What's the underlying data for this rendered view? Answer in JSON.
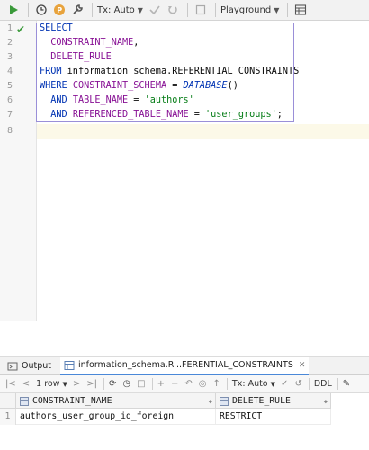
{
  "toolbar": {
    "tx_mode": "Tx: Auto",
    "playground": "Playground"
  },
  "editor": {
    "line_numbers": [
      "1",
      "2",
      "3",
      "4",
      "5",
      "6",
      "7",
      "8"
    ],
    "lines": [
      [
        {
          "t": "SELECT",
          "c": "kw"
        }
      ],
      [
        {
          "t": "  CONSTRAINT_NAME",
          "c": "id"
        },
        {
          "t": ",",
          "c": "plain"
        }
      ],
      [
        {
          "t": "  DELETE_RULE",
          "c": "id"
        }
      ],
      [
        {
          "t": "FROM ",
          "c": "kw"
        },
        {
          "t": "information_schema.REFERENTIAL_CONSTRAINTS",
          "c": "plain"
        }
      ],
      [
        {
          "t": "WHERE ",
          "c": "kw"
        },
        {
          "t": "CONSTRAINT_SCHEMA",
          "c": "id"
        },
        {
          "t": " = ",
          "c": "plain"
        },
        {
          "t": "DATABASE",
          "c": "fn"
        },
        {
          "t": "()",
          "c": "plain"
        }
      ],
      [
        {
          "t": "  AND ",
          "c": "kw"
        },
        {
          "t": "TABLE_NAME",
          "c": "id"
        },
        {
          "t": " = ",
          "c": "plain"
        },
        {
          "t": "'authors'",
          "c": "str"
        }
      ],
      [
        {
          "t": "  AND ",
          "c": "kw"
        },
        {
          "t": "REFERENCED_TABLE_NAME",
          "c": "id"
        },
        {
          "t": " = ",
          "c": "plain"
        },
        {
          "t": "'user_groups'",
          "c": "str"
        },
        {
          "t": ";",
          "c": "plain"
        }
      ],
      []
    ]
  },
  "results_tabs": [
    {
      "label": "Output"
    },
    {
      "label": "information_schema.R...FERENTIAL_CONSTRAINTS"
    }
  ],
  "results_toolbar": {
    "rows_label": "1 row",
    "tx_mode": "Tx: Auto",
    "ddl": "DDL"
  },
  "grid": {
    "columns": [
      "CONSTRAINT_NAME",
      "DELETE_RULE"
    ],
    "rows": [
      {
        "num": "1",
        "cells": [
          "authors_user_group_id_foreign",
          "RESTRICT"
        ]
      }
    ]
  },
  "colors": {
    "keyword": "#0033b3",
    "identifier": "#871094",
    "string": "#067d17",
    "run_green": "#3a9a3a",
    "current_line": "#fcf9e8"
  }
}
